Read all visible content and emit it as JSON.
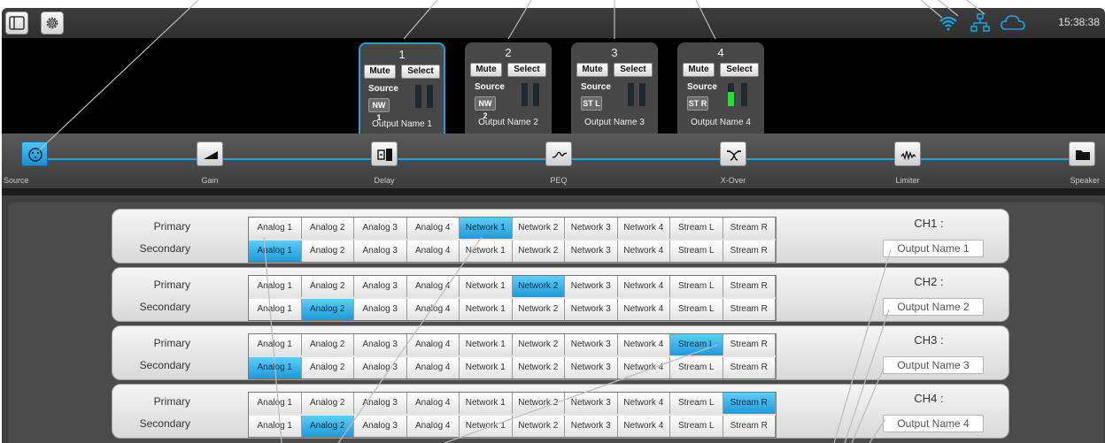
{
  "topbar": {
    "clock": "15:38:38",
    "icons": [
      "sidebar-toggle-icon",
      "gear-icon",
      "wifi-icon",
      "network-icon",
      "cloud-icon"
    ],
    "status_color": "#1aa3e0"
  },
  "outputs": [
    {
      "num": "1",
      "mute": "Mute",
      "select": "Select",
      "source_label": "Source",
      "source": "NW 1",
      "name": "Output Name 1",
      "active": true,
      "level": 0
    },
    {
      "num": "2",
      "mute": "Mute",
      "select": "Select",
      "source_label": "Source",
      "source": "NW 2",
      "name": "Output Name 2",
      "active": false,
      "level": 0
    },
    {
      "num": "3",
      "mute": "Mute",
      "select": "Select",
      "source_label": "Source",
      "source": "ST L",
      "name": "Output Name 3",
      "active": false,
      "level": 0
    },
    {
      "num": "4",
      "mute": "Mute",
      "select": "Select",
      "source_label": "Source",
      "source": "ST R",
      "name": "Output Name 4",
      "active": false,
      "level": 0.62
    }
  ],
  "chain": [
    {
      "label": "Source",
      "icon": "xlr-connector-icon",
      "active": true
    },
    {
      "label": "Gain",
      "icon": "gain-ramp-icon",
      "active": false
    },
    {
      "label": "Delay",
      "icon": "delay-icon",
      "active": false
    },
    {
      "label": "PEQ",
      "icon": "peq-curve-icon",
      "active": false
    },
    {
      "label": "X-Over",
      "icon": "crossover-icon",
      "active": false
    },
    {
      "label": "Limiter",
      "icon": "limiter-wave-icon",
      "active": false
    },
    {
      "label": "Speaker",
      "icon": "folder-icon",
      "active": false
    }
  ],
  "routing": {
    "primary_label": "Primary",
    "secondary_label": "Secondary",
    "sources": [
      "Analog 1",
      "Analog 2",
      "Analog 3",
      "Analog 4",
      "Network 1",
      "Network 2",
      "Network 3",
      "Network 4",
      "Stream L",
      "Stream R"
    ],
    "channels": [
      {
        "title": "CH1 :",
        "name": "Output Name 1",
        "primary": 4,
        "secondary": 0
      },
      {
        "title": "CH2 :",
        "name": "Output Name 2",
        "primary": 5,
        "secondary": 1
      },
      {
        "title": "CH3 :",
        "name": "Output Name 3",
        "primary": 8,
        "secondary": 0
      },
      {
        "title": "CH4 :",
        "name": "Output Name 4",
        "primary": 9,
        "secondary": 1
      }
    ],
    "selected_color": "#1d9bd9"
  }
}
